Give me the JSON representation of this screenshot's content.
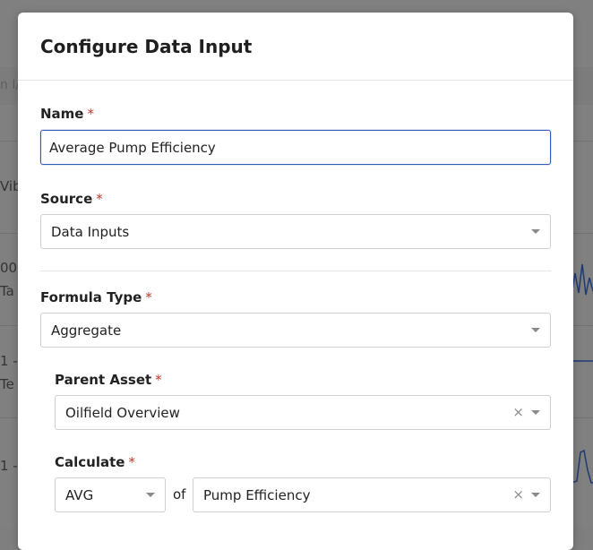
{
  "modal": {
    "title": "Configure Data Input",
    "required_marker": "*",
    "name": {
      "label": "Name",
      "value": "Average Pump Efficiency"
    },
    "source": {
      "label": "Source",
      "value": "Data Inputs"
    },
    "formula_type": {
      "label": "Formula Type",
      "value": "Aggregate"
    },
    "parent_asset": {
      "label": "Parent Asset",
      "value": "Oilfield Overview"
    },
    "calculate": {
      "label": "Calculate",
      "function": "AVG",
      "of_label": "of",
      "input": "Pump Efficiency"
    },
    "clear_glyph": "×"
  },
  "background": {
    "fragments": [
      "n I/",
      "Vib",
      "00",
      "Ta",
      "1 -",
      "Te",
      "1 -"
    ]
  },
  "colors": {
    "accent": "#2f5ab5",
    "required": "#c0392b",
    "backdrop": "#808080"
  }
}
